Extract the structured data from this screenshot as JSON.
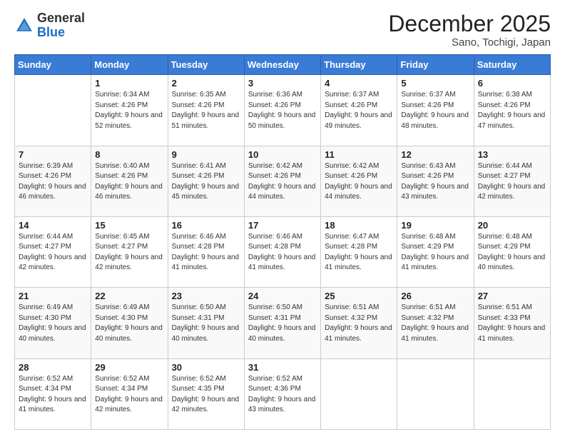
{
  "header": {
    "logo_general": "General",
    "logo_blue": "Blue",
    "month_title": "December 2025",
    "location": "Sano, Tochigi, Japan"
  },
  "days_of_week": [
    "Sunday",
    "Monday",
    "Tuesday",
    "Wednesday",
    "Thursday",
    "Friday",
    "Saturday"
  ],
  "weeks": [
    [
      {
        "day": "",
        "sunrise": "",
        "sunset": "",
        "daylight": ""
      },
      {
        "day": "1",
        "sunrise": "Sunrise: 6:34 AM",
        "sunset": "Sunset: 4:26 PM",
        "daylight": "Daylight: 9 hours and 52 minutes."
      },
      {
        "day": "2",
        "sunrise": "Sunrise: 6:35 AM",
        "sunset": "Sunset: 4:26 PM",
        "daylight": "Daylight: 9 hours and 51 minutes."
      },
      {
        "day": "3",
        "sunrise": "Sunrise: 6:36 AM",
        "sunset": "Sunset: 4:26 PM",
        "daylight": "Daylight: 9 hours and 50 minutes."
      },
      {
        "day": "4",
        "sunrise": "Sunrise: 6:37 AM",
        "sunset": "Sunset: 4:26 PM",
        "daylight": "Daylight: 9 hours and 49 minutes."
      },
      {
        "day": "5",
        "sunrise": "Sunrise: 6:37 AM",
        "sunset": "Sunset: 4:26 PM",
        "daylight": "Daylight: 9 hours and 48 minutes."
      },
      {
        "day": "6",
        "sunrise": "Sunrise: 6:38 AM",
        "sunset": "Sunset: 4:26 PM",
        "daylight": "Daylight: 9 hours and 47 minutes."
      }
    ],
    [
      {
        "day": "7",
        "sunrise": "Sunrise: 6:39 AM",
        "sunset": "Sunset: 4:26 PM",
        "daylight": "Daylight: 9 hours and 46 minutes."
      },
      {
        "day": "8",
        "sunrise": "Sunrise: 6:40 AM",
        "sunset": "Sunset: 4:26 PM",
        "daylight": "Daylight: 9 hours and 46 minutes."
      },
      {
        "day": "9",
        "sunrise": "Sunrise: 6:41 AM",
        "sunset": "Sunset: 4:26 PM",
        "daylight": "Daylight: 9 hours and 45 minutes."
      },
      {
        "day": "10",
        "sunrise": "Sunrise: 6:42 AM",
        "sunset": "Sunset: 4:26 PM",
        "daylight": "Daylight: 9 hours and 44 minutes."
      },
      {
        "day": "11",
        "sunrise": "Sunrise: 6:42 AM",
        "sunset": "Sunset: 4:26 PM",
        "daylight": "Daylight: 9 hours and 44 minutes."
      },
      {
        "day": "12",
        "sunrise": "Sunrise: 6:43 AM",
        "sunset": "Sunset: 4:26 PM",
        "daylight": "Daylight: 9 hours and 43 minutes."
      },
      {
        "day": "13",
        "sunrise": "Sunrise: 6:44 AM",
        "sunset": "Sunset: 4:27 PM",
        "daylight": "Daylight: 9 hours and 42 minutes."
      }
    ],
    [
      {
        "day": "14",
        "sunrise": "Sunrise: 6:44 AM",
        "sunset": "Sunset: 4:27 PM",
        "daylight": "Daylight: 9 hours and 42 minutes."
      },
      {
        "day": "15",
        "sunrise": "Sunrise: 6:45 AM",
        "sunset": "Sunset: 4:27 PM",
        "daylight": "Daylight: 9 hours and 42 minutes."
      },
      {
        "day": "16",
        "sunrise": "Sunrise: 6:46 AM",
        "sunset": "Sunset: 4:28 PM",
        "daylight": "Daylight: 9 hours and 41 minutes."
      },
      {
        "day": "17",
        "sunrise": "Sunrise: 6:46 AM",
        "sunset": "Sunset: 4:28 PM",
        "daylight": "Daylight: 9 hours and 41 minutes."
      },
      {
        "day": "18",
        "sunrise": "Sunrise: 6:47 AM",
        "sunset": "Sunset: 4:28 PM",
        "daylight": "Daylight: 9 hours and 41 minutes."
      },
      {
        "day": "19",
        "sunrise": "Sunrise: 6:48 AM",
        "sunset": "Sunset: 4:29 PM",
        "daylight": "Daylight: 9 hours and 41 minutes."
      },
      {
        "day": "20",
        "sunrise": "Sunrise: 6:48 AM",
        "sunset": "Sunset: 4:29 PM",
        "daylight": "Daylight: 9 hours and 40 minutes."
      }
    ],
    [
      {
        "day": "21",
        "sunrise": "Sunrise: 6:49 AM",
        "sunset": "Sunset: 4:30 PM",
        "daylight": "Daylight: 9 hours and 40 minutes."
      },
      {
        "day": "22",
        "sunrise": "Sunrise: 6:49 AM",
        "sunset": "Sunset: 4:30 PM",
        "daylight": "Daylight: 9 hours and 40 minutes."
      },
      {
        "day": "23",
        "sunrise": "Sunrise: 6:50 AM",
        "sunset": "Sunset: 4:31 PM",
        "daylight": "Daylight: 9 hours and 40 minutes."
      },
      {
        "day": "24",
        "sunrise": "Sunrise: 6:50 AM",
        "sunset": "Sunset: 4:31 PM",
        "daylight": "Daylight: 9 hours and 40 minutes."
      },
      {
        "day": "25",
        "sunrise": "Sunrise: 6:51 AM",
        "sunset": "Sunset: 4:32 PM",
        "daylight": "Daylight: 9 hours and 41 minutes."
      },
      {
        "day": "26",
        "sunrise": "Sunrise: 6:51 AM",
        "sunset": "Sunset: 4:32 PM",
        "daylight": "Daylight: 9 hours and 41 minutes."
      },
      {
        "day": "27",
        "sunrise": "Sunrise: 6:51 AM",
        "sunset": "Sunset: 4:33 PM",
        "daylight": "Daylight: 9 hours and 41 minutes."
      }
    ],
    [
      {
        "day": "28",
        "sunrise": "Sunrise: 6:52 AM",
        "sunset": "Sunset: 4:34 PM",
        "daylight": "Daylight: 9 hours and 41 minutes."
      },
      {
        "day": "29",
        "sunrise": "Sunrise: 6:52 AM",
        "sunset": "Sunset: 4:34 PM",
        "daylight": "Daylight: 9 hours and 42 minutes."
      },
      {
        "day": "30",
        "sunrise": "Sunrise: 6:52 AM",
        "sunset": "Sunset: 4:35 PM",
        "daylight": "Daylight: 9 hours and 42 minutes."
      },
      {
        "day": "31",
        "sunrise": "Sunrise: 6:52 AM",
        "sunset": "Sunset: 4:36 PM",
        "daylight": "Daylight: 9 hours and 43 minutes."
      },
      {
        "day": "",
        "sunrise": "",
        "sunset": "",
        "daylight": ""
      },
      {
        "day": "",
        "sunrise": "",
        "sunset": "",
        "daylight": ""
      },
      {
        "day": "",
        "sunrise": "",
        "sunset": "",
        "daylight": ""
      }
    ]
  ]
}
